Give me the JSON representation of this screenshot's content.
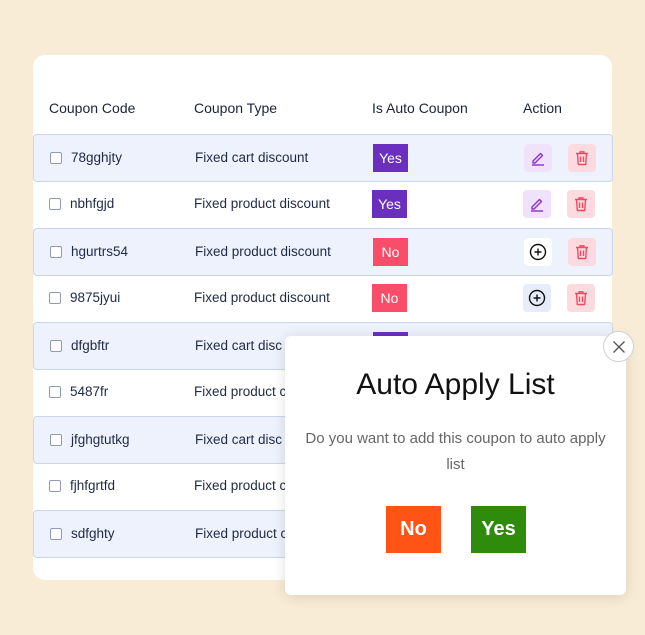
{
  "table": {
    "headers": {
      "code": "Coupon Code",
      "type": "Coupon Type",
      "auto": "Is Auto Coupon",
      "action": "Action"
    },
    "rows": [
      {
        "code": "78gghjty",
        "type": "Fixed cart discount",
        "auto": "Yes"
      },
      {
        "code": "nbhfgjd",
        "type": "Fixed product discount",
        "auto": "Yes"
      },
      {
        "code": "hgurtrs54",
        "type": "Fixed product discount",
        "auto": "No"
      },
      {
        "code": "9875jyui",
        "type": "Fixed product discount",
        "auto": "No"
      },
      {
        "code": "dfgbftr",
        "type": "Fixed cart disc",
        "auto": ""
      },
      {
        "code": "5487fr",
        "type": "Fixed product c",
        "auto": ""
      },
      {
        "code": "jfghgtutkg",
        "type": "Fixed cart disc",
        "auto": ""
      },
      {
        "code": "fjhfgrtfd",
        "type": "Fixed product c",
        "auto": ""
      },
      {
        "code": "sdfghty",
        "type": "Fixed product c",
        "auto": ""
      }
    ]
  },
  "modal": {
    "title": "Auto Apply List",
    "message": "Do you want to add this coupon  to auto apply list",
    "no_label": "No",
    "yes_label": "Yes"
  },
  "colors": {
    "background": "#f8ecd6",
    "yes_badge": "#6b2fbf",
    "no_badge": "#fa4d6a",
    "modal_no": "#ff5416",
    "modal_yes": "#2e8b0c"
  },
  "icons": {
    "edit": "pencil-icon",
    "delete": "trash-icon",
    "add": "plus-circle-icon",
    "close": "close-icon"
  }
}
